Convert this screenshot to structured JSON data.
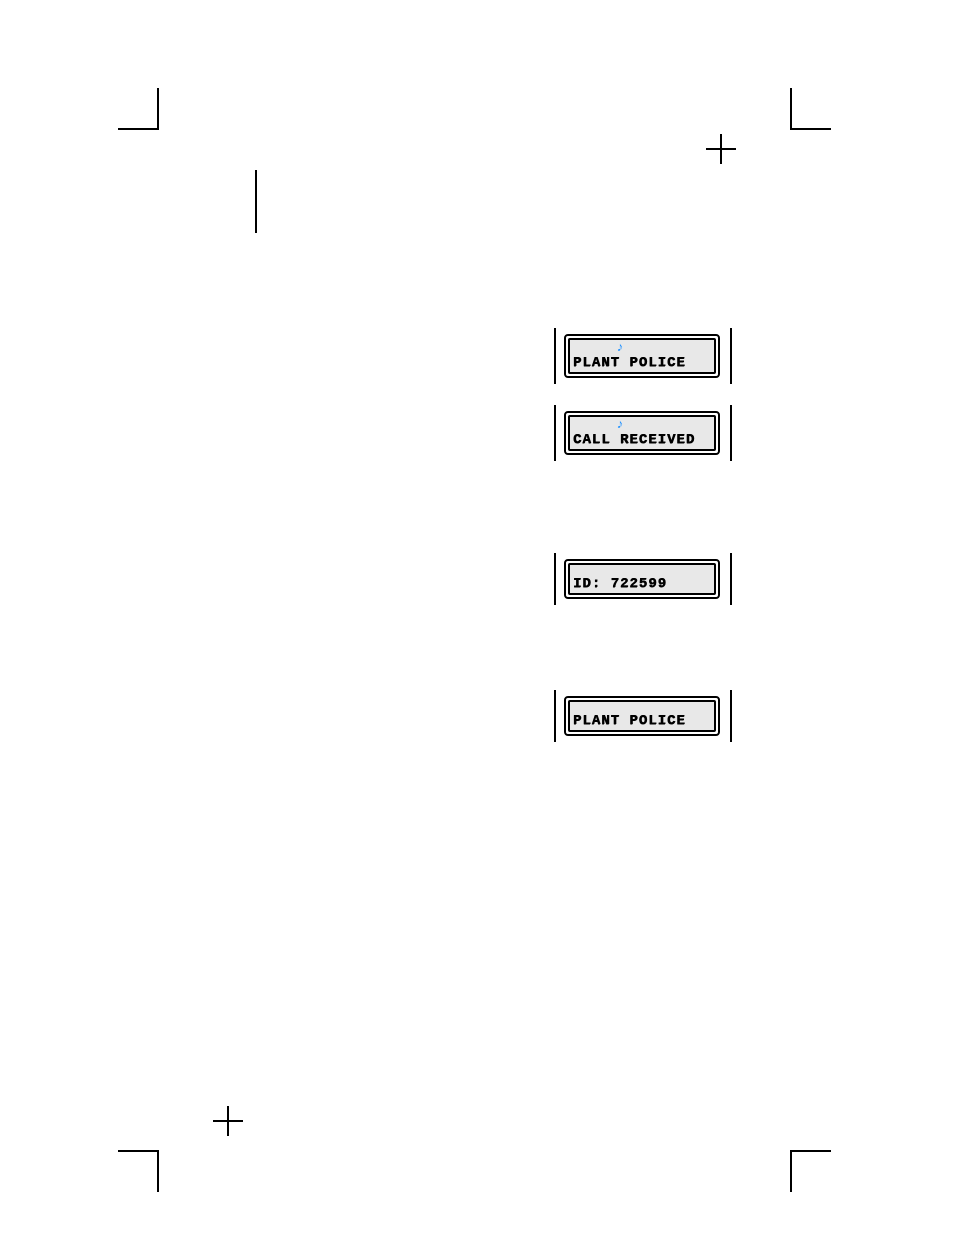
{
  "lcds": [
    {
      "name": "plant-police-1",
      "text": "PLANT POLICE",
      "note": true
    },
    {
      "name": "call-received",
      "text": "CALL RECEIVED",
      "note": true
    },
    {
      "name": "id-line",
      "text": "ID: 722599",
      "note": false
    },
    {
      "name": "plant-police-2",
      "text": "PLANT POLICE",
      "note": false
    }
  ]
}
